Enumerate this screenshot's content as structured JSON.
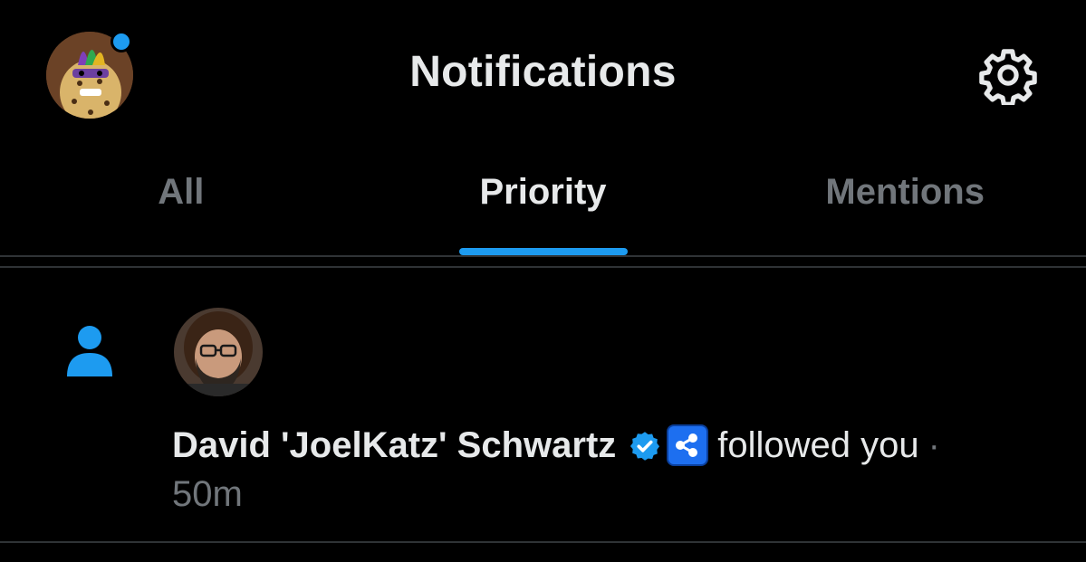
{
  "header": {
    "title": "Notifications",
    "avatar_icon": "leopard-mardi-gras-avatar",
    "settings_icon": "gear-icon"
  },
  "tabs": [
    {
      "label": "All",
      "active": false
    },
    {
      "label": "Priority",
      "active": true
    },
    {
      "label": "Mentions",
      "active": false
    }
  ],
  "notifications": [
    {
      "type_icon": "person-icon",
      "actor_name": "David 'JoelKatz' Schwartz",
      "verified_icon": "verified-badge-icon",
      "affiliate_icon": "ripple-logo-icon",
      "action": "followed you",
      "separator": "·",
      "time": "50m"
    }
  ],
  "colors": {
    "background": "#000000",
    "accent": "#1d9bf0",
    "primary_text": "#e7e9ea",
    "secondary_text": "#71767b",
    "divider": "#2f3336"
  }
}
